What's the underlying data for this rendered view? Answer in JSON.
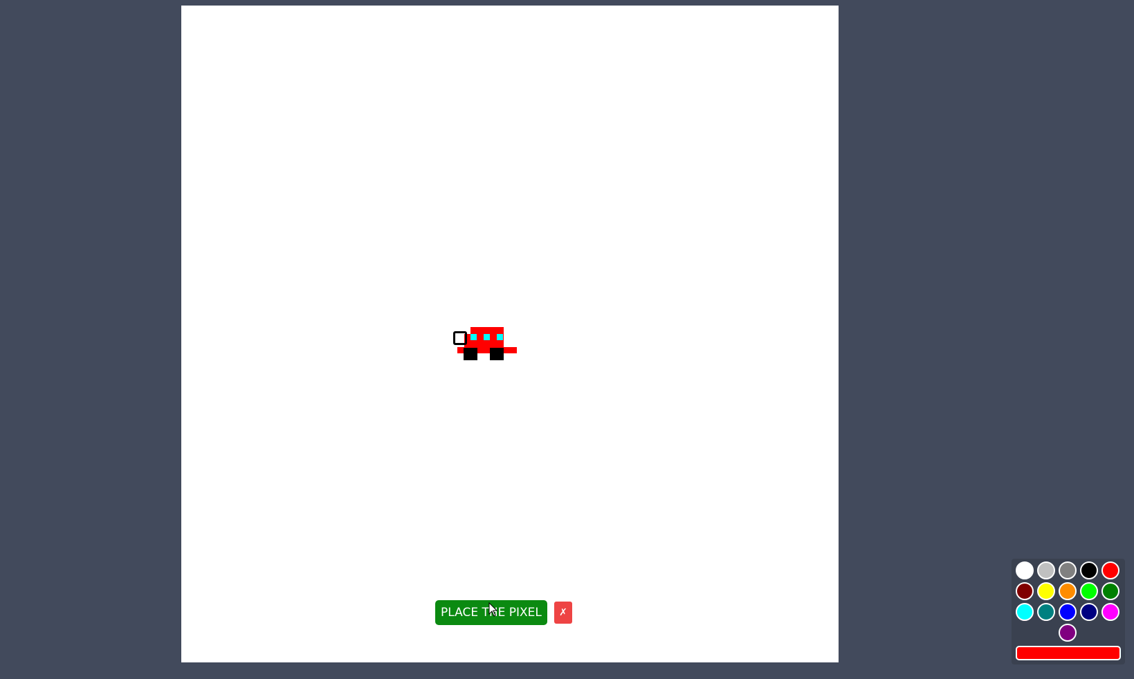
{
  "canvas": {
    "background": "#ffffff",
    "pixels": [
      {
        "color": "#ff0000"
      },
      {
        "color": "#ff0000"
      },
      {
        "color": "#00ffff"
      },
      {
        "color": "#00ffff"
      },
      {
        "color": "#00ffff"
      },
      {
        "color": "#ff0000"
      },
      {
        "color": "#ff0000"
      },
      {
        "color": "#000000"
      },
      {
        "color": "#000000"
      }
    ]
  },
  "controls": {
    "place_label": "PLACE THE PIXEL",
    "cancel_label": "✗"
  },
  "palette": {
    "colors": [
      "#ffffff",
      "#c0c0c0",
      "#808080",
      "#000000",
      "#ff0000",
      "#800000",
      "#ffff00",
      "#ff8c00",
      "#00ff00",
      "#008000",
      "#00ffff",
      "#008080",
      "#0000ff",
      "#000080",
      "#ff00ff",
      "#800080"
    ],
    "selected": "#ff0000"
  }
}
